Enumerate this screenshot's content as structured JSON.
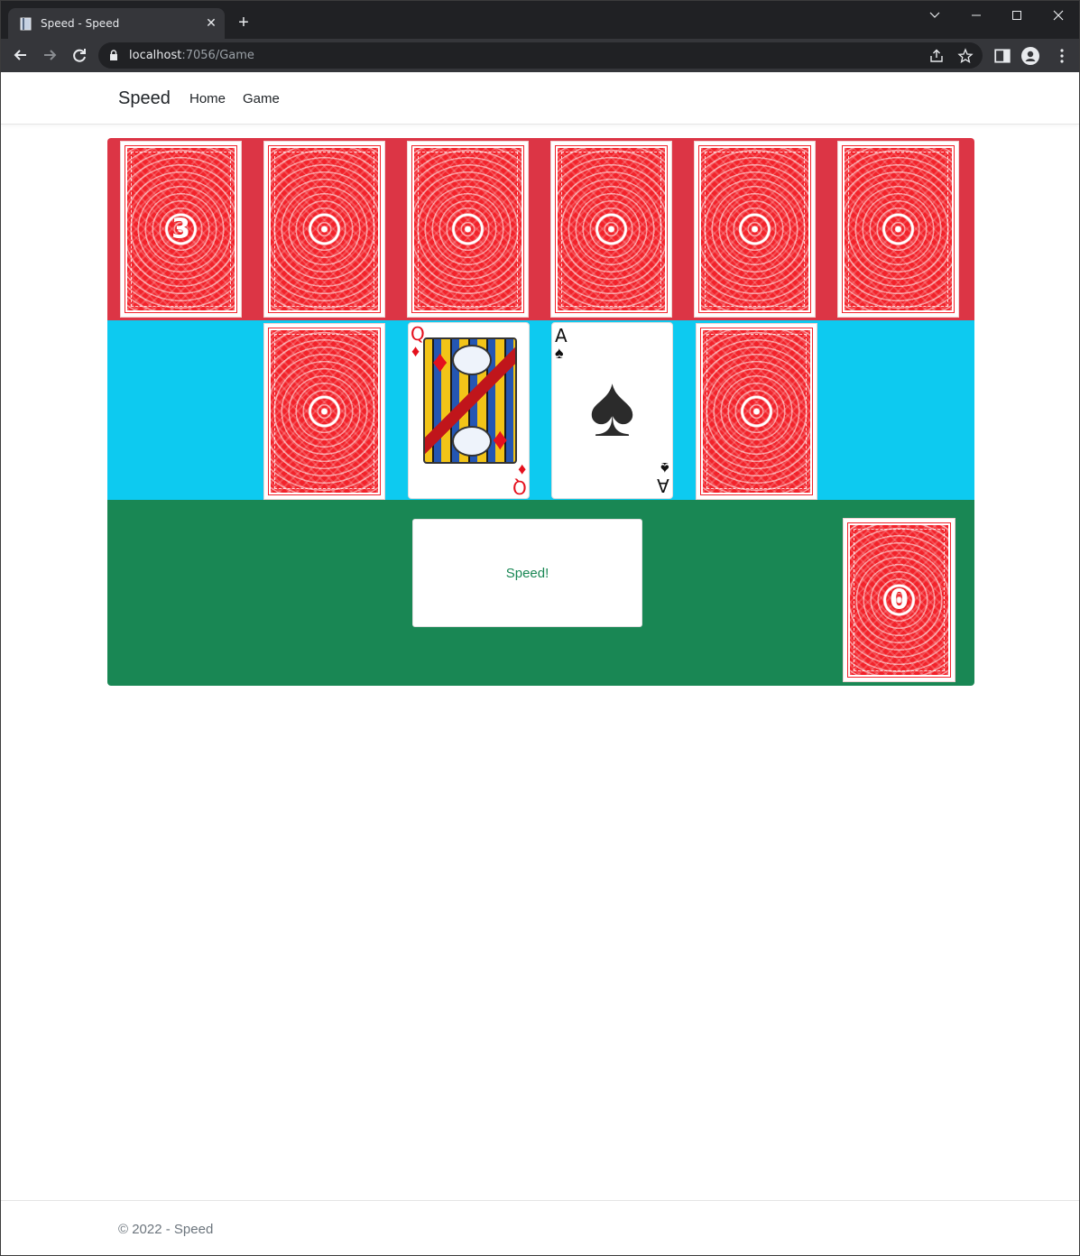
{
  "browser": {
    "tab_title": "Speed - Speed",
    "tab_close": "✕",
    "new_tab": "+",
    "url_host": "localhost",
    "url_path": ":7056/Game"
  },
  "navbar": {
    "brand": "Speed",
    "links": [
      "Home",
      "Game"
    ]
  },
  "board": {
    "opponent_row": {
      "color": "#dc3545",
      "draw_pile_count": "3",
      "hand_cards": 5
    },
    "center_row": {
      "color": "#0dcaf0",
      "left_stock": "card-back",
      "left_play_pile": {
        "rank": "Q",
        "suit": "♦",
        "suit_name": "diamonds"
      },
      "right_play_pile": {
        "rank": "A",
        "suit": "♠",
        "suit_name": "spades"
      },
      "right_stock": "card-back"
    },
    "player_row": {
      "color": "#198754",
      "speed_button": "Speed!",
      "draw_pile_count": "0"
    }
  },
  "footer": {
    "text": "© 2022 - Speed"
  }
}
